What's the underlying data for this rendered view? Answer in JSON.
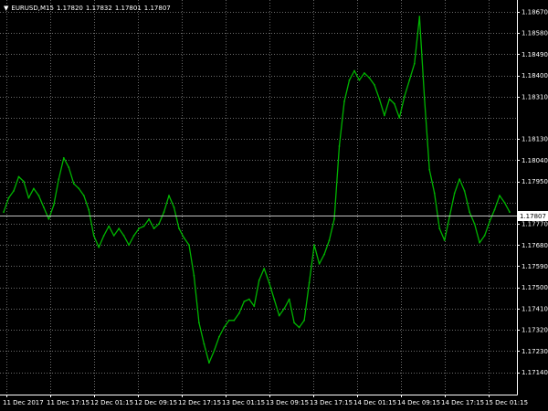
{
  "window": {
    "symbol_tf": "EURUSD,M15",
    "ohlc": [
      "1.17820",
      "1.17832",
      "1.17801",
      "1.17807"
    ]
  },
  "colors": {
    "background": "#000000",
    "grid": "#6b6b6b",
    "price_line": "#00b400",
    "axis_text": "#ffffff",
    "bid_line": "#c0c0c0"
  },
  "price_axis": {
    "labels": [
      "1.18670",
      "1.18580",
      "1.18490",
      "1.18400",
      "1.18310",
      "1.18130",
      "1.18040",
      "1.17950",
      "1.17770",
      "1.17680",
      "1.17590",
      "1.17500",
      "1.17410",
      "1.17320",
      "1.17230",
      "1.17140"
    ],
    "current_price": "1.17807"
  },
  "time_axis": {
    "labels": [
      "11 Dec 2017",
      "11 Dec 17:15",
      "12 Dec 01:15",
      "12 Dec 09:15",
      "12 Dec 17:15",
      "13 Dec 01:15",
      "13 Dec 09:15",
      "13 Dec 17:15",
      "14 Dec 01:15",
      "14 Dec 09:15",
      "14 Dec 17:15",
      "15 Dec 01:15"
    ]
  },
  "chart_data": {
    "type": "line",
    "series": [
      {
        "values": [
          1.1782,
          1.1788,
          1.1791,
          1.1797,
          1.1795,
          1.1788,
          1.1792,
          1.1789,
          1.1784,
          1.1779,
          1.1785,
          1.1796,
          1.1805,
          1.1801,
          1.1794,
          1.1792,
          1.1789,
          1.1783,
          1.1772,
          1.1767,
          1.1772,
          1.1776,
          1.1772,
          1.1775,
          1.1772,
          1.1768,
          1.1772,
          1.1775,
          1.1776,
          1.1779,
          1.1775,
          1.1777,
          1.1782,
          1.1789,
          1.1784,
          1.1775,
          1.1771,
          1.1768,
          1.1755,
          1.1735,
          1.1726,
          1.1718,
          1.1723,
          1.1729,
          1.1733,
          1.1736,
          1.1736,
          1.1739,
          1.1744,
          1.1745,
          1.1742,
          1.1753,
          1.1758,
          1.1752,
          1.1745,
          1.1738,
          1.1741,
          1.1745,
          1.1735,
          1.1733,
          1.1736,
          1.1752,
          1.1768,
          1.176,
          1.1764,
          1.177,
          1.1779,
          1.181,
          1.1829,
          1.1838,
          1.1842,
          1.1838,
          1.1841,
          1.1839,
          1.1836,
          1.183,
          1.1823,
          1.183,
          1.1828,
          1.1822,
          1.1831,
          1.1838,
          1.1845,
          1.1865,
          1.183,
          1.18,
          1.179,
          1.1775,
          1.177,
          1.178,
          1.179,
          1.1796,
          1.1791,
          1.1782,
          1.1777,
          1.1769,
          1.1772,
          1.1778,
          1.1783,
          1.1789,
          1.1786,
          1.1782
        ]
      }
    ],
    "ylim": [
      1.1714,
      1.1867
    ]
  }
}
